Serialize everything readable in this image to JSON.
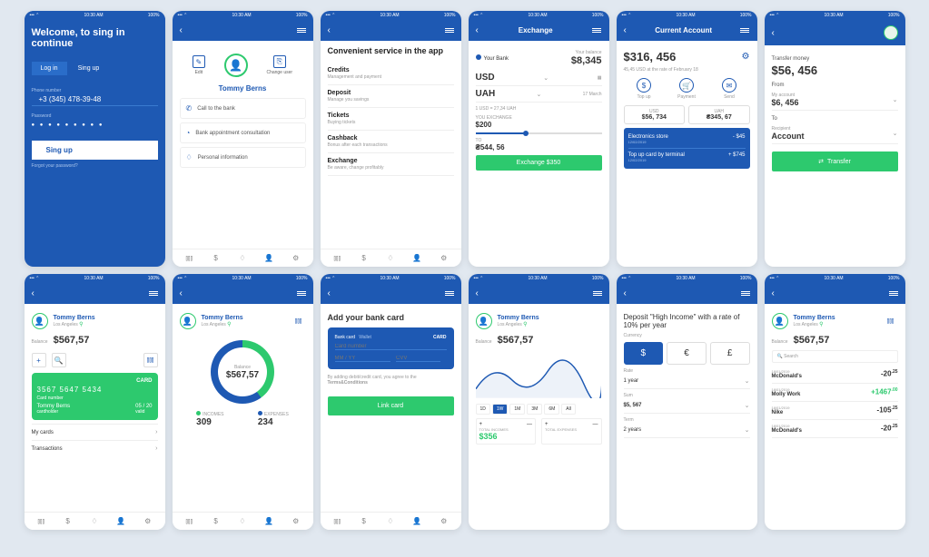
{
  "status": {
    "time": "10:30 AM",
    "battery": "100%"
  },
  "nav": [
    "stats-icon",
    "dollar-icon",
    "shield-icon",
    "person-icon",
    "gear-icon"
  ],
  "s1": {
    "welcome": "Welcome, to sing in continue",
    "login_tab": "Log in",
    "signup_tab": "Sing up",
    "phone_label": "Phone number",
    "phone": "+3 (345) 478-39-48",
    "pass_label": "Password",
    "signup_btn": "Sing up",
    "forgot": "Forgot your password?"
  },
  "s2": {
    "edit": "Edit",
    "change": "Change user",
    "name": "Tommy Berns",
    "call": "Call to the bank",
    "appt": "Bank appointment consultation",
    "personal": "Personal information"
  },
  "s3": {
    "title": "Convenient service in the app",
    "items": [
      {
        "h": "Credits",
        "s": "Management and payment"
      },
      {
        "h": "Deposit",
        "s": "Manage you savings"
      },
      {
        "h": "Tickets",
        "s": "Buying tickets"
      },
      {
        "h": "Cashback",
        "s": "Bonus after each transactions"
      },
      {
        "h": "Exchange",
        "s": "Be aware, change profitably"
      }
    ]
  },
  "s4": {
    "title": "Exchange",
    "bank": "Your Bank",
    "bal_label": "Your balance",
    "bal": "$8,345",
    "from": "USD",
    "to": "UAH",
    "date": "17 March",
    "rate": "1 USD = 27,34 UAH",
    "you_ex": "YOU EXCHANGE",
    "amount": "$200",
    "to_label": "TO",
    "result": "₴544, 56",
    "btn": "Exchange $350"
  },
  "s5": {
    "title": "Current Account",
    "amount": "$316, 456",
    "note": "45,45 USD at the rate of February 18",
    "topup": "Top up",
    "payment": "Payment",
    "send": "Send",
    "usd_l": "USD",
    "usd": "$56, 734",
    "uah_l": "UAH",
    "uah": "₴345, 67",
    "tx1": "Electronics store",
    "tx1d": "12/02/2019",
    "tx1a": "- $45",
    "tx2": "Top up card by terminal",
    "tx2d": "12/02/2019",
    "tx2a": "+ $745"
  },
  "s6": {
    "title": "Transfer money",
    "amount": "$56, 456",
    "from": "From",
    "my": "My account",
    "my_amt": "$6, 456",
    "to": "To",
    "recip": "Recipient",
    "acc": "Account",
    "btn": "Transfer"
  },
  "s7": {
    "name": "Tommy Berns",
    "loc": "Los Angeles",
    "bal_l": "Balance",
    "bal": "$567,57",
    "card_num": "3567 5647 5434",
    "card_label": "Card number",
    "holder": "Tommy Berns",
    "holder_l": "cardholder",
    "exp": "05 / 20",
    "exp_l": "valid",
    "card_tag": "CARD",
    "my_cards": "My cards",
    "trans": "Transactions"
  },
  "s8": {
    "name": "Tommy Berns",
    "loc": "Los Angeles",
    "bal_l": "Balance",
    "bal": "$567,57",
    "inc_l": "INCOMES",
    "inc": "309",
    "exp_l": "EXPENSES",
    "exp": "234"
  },
  "s9": {
    "title": "Add your bank card",
    "bank": "Bank card",
    "wallet": "Wallet",
    "tag": "CARD",
    "cn": "Card number",
    "mm": "MM / YY",
    "cvv": "CVV",
    "terms": "By adding debit/credit card, you agree to the",
    "terms2": "Terms&Conditions",
    "btn": "Link card"
  },
  "s10": {
    "name": "Tommy Berns",
    "loc": "Los Angeles",
    "bal_l": "Balance",
    "bal": "$567,57",
    "periods": [
      "1D",
      "1W",
      "1M",
      "3M",
      "6M",
      "All"
    ],
    "active": "1W",
    "ti_l": "TOTAL INCOMES",
    "ti": "$356",
    "te_l": "TOTAL EXPENSES"
  },
  "s11": {
    "title": "Deposit \"High Income\" with a rate of 10% per year",
    "cur_l": "Currency",
    "curs": [
      "$",
      "€",
      "£"
    ],
    "rate_l": "Rate",
    "rate": "1 year",
    "sum_l": "Sum",
    "sum": "$5, 567",
    "term_l": "Term",
    "term": "2 years"
  },
  "s12": {
    "name": "Tommy Berns",
    "loc": "Los Angeles",
    "bal_l": "Balance",
    "bal": "$567,57",
    "search": "Search",
    "items": [
      {
        "d": "18/01/2019",
        "n": "McDonald's",
        "a": "-20",
        "c": "25"
      },
      {
        "d": "18/01/2019",
        "n": "Molly Work",
        "a": "+1467",
        "c": "00"
      },
      {
        "d": "18/01/2019",
        "n": "Nike",
        "a": "-105",
        "c": "25"
      },
      {
        "d": "18/01/2019",
        "n": "McDonald's",
        "a": "-20",
        "c": "25"
      }
    ]
  }
}
